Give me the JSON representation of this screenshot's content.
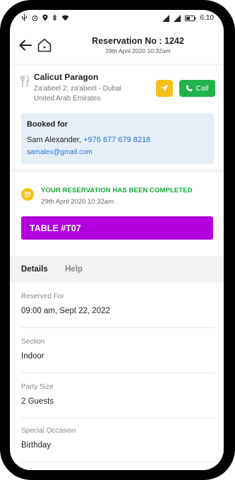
{
  "status_bar": {
    "time": "6:10"
  },
  "header": {
    "title": "Reservation No : 1242",
    "subtitle": "29th April 2020 10:32am"
  },
  "restaurant": {
    "name": "Calicut Paragon",
    "address_line1": "Za'abeel 2, za'abeel - Dubai",
    "address_line2": "United Arab Emirates",
    "call_label": "Call",
    "colors": {
      "navigate": "#f4c01c",
      "call": "#1fb34a"
    }
  },
  "booked_for": {
    "title": "Booked for",
    "name": "Sam Alexander,",
    "phone": "+976 677 679 8218",
    "email": "samalex@gmail.com"
  },
  "reservation_status": {
    "title": "YOUR RESERVATION HAS BEEN COMPLETED",
    "date": "29th April 2020 10:32am",
    "table_label": "TABLE #T07",
    "colors": {
      "title": "#13a836",
      "table": "#b300dd"
    }
  },
  "tabs": [
    {
      "label": "Details",
      "active": true
    },
    {
      "label": "Help",
      "active": false
    }
  ],
  "details": [
    {
      "label": "Reserved For",
      "value": "09:00 am, Sept 22, 2022"
    },
    {
      "label": "Section",
      "value": "Indoor"
    },
    {
      "label": "Party Size",
      "value": "2 Guests"
    },
    {
      "label": "Special Occasion",
      "value": "Birthday"
    }
  ]
}
